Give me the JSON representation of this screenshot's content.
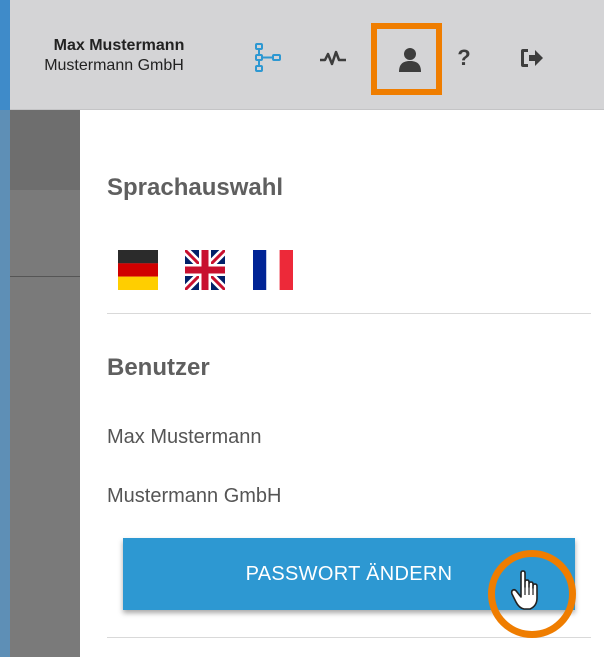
{
  "header": {
    "user_name": "Max Mustermann",
    "user_company": "Mustermann GmbH",
    "icons": [
      "flow-diagram-icon",
      "pulse-icon",
      "user-icon",
      "help-icon",
      "logout-icon"
    ],
    "help_glyph": "?",
    "accent": "#3f8bc9"
  },
  "panel": {
    "language_title": "Sprachauswahl",
    "languages": [
      "de",
      "en",
      "fr"
    ],
    "user_title": "Benutzer",
    "user_name": "Max Mustermann",
    "user_company": "Mustermann GmbH",
    "change_password_label": "PASSWORT ÄNDERN",
    "button_color": "#2d98d2"
  },
  "highlight_color": "#ef7d00"
}
